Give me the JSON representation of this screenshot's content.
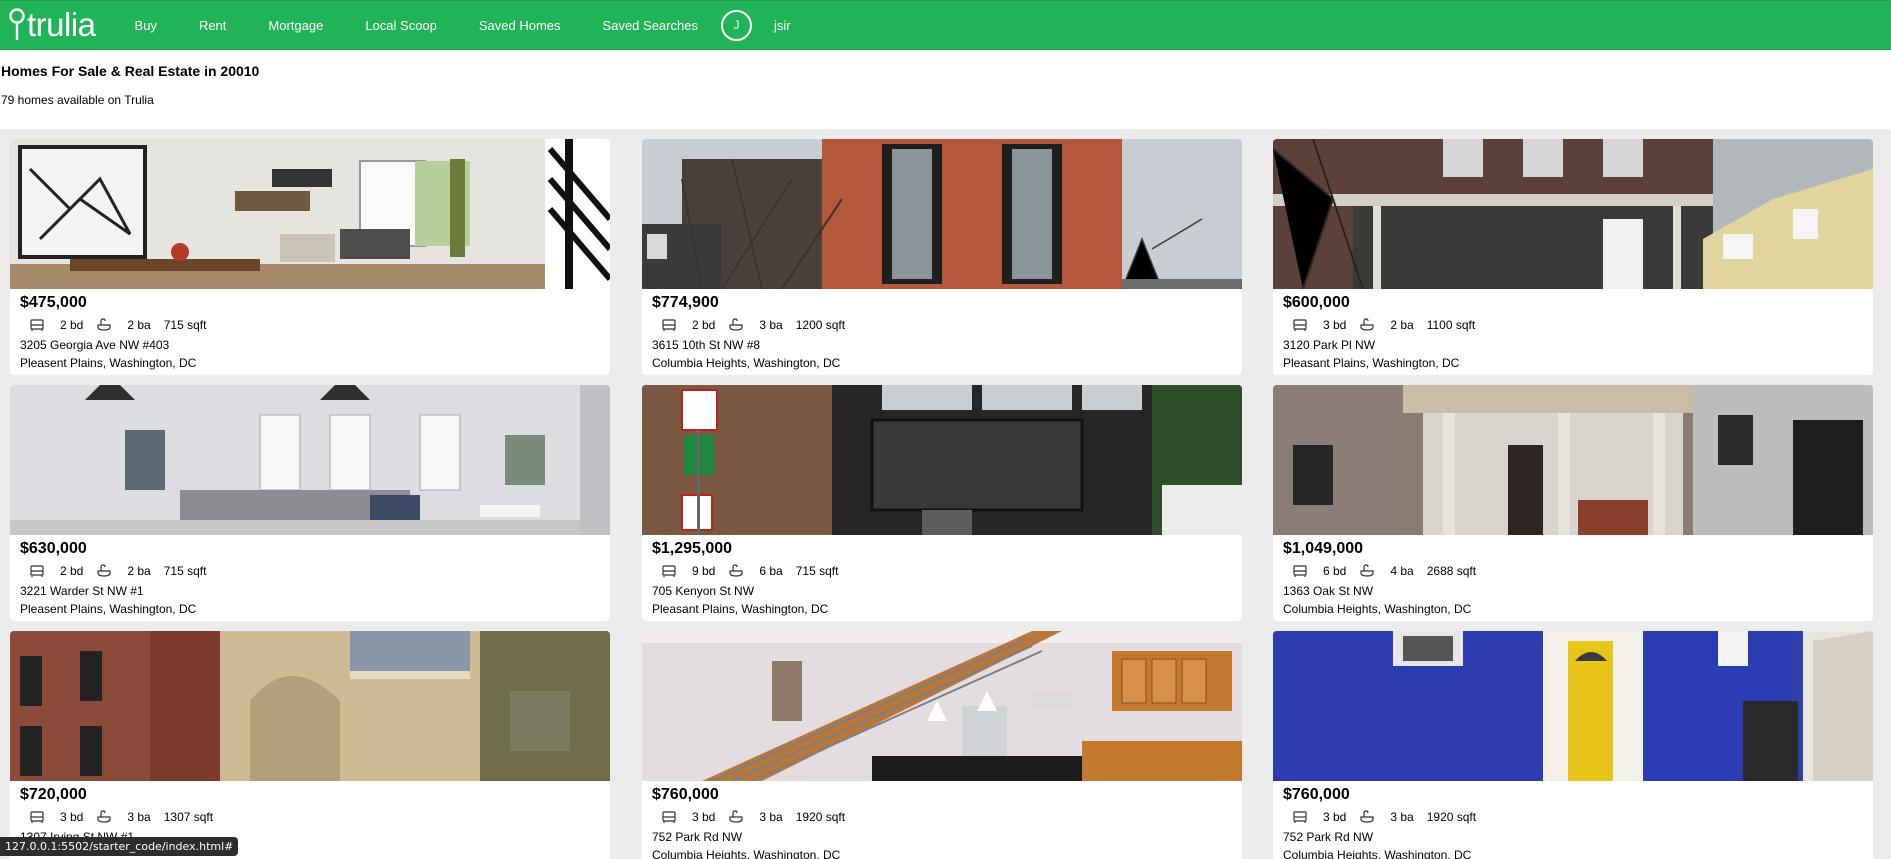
{
  "brand": {
    "name": "trulia",
    "accent": "#21b357"
  },
  "nav": {
    "links": [
      "Buy",
      "Rent",
      "Mortgage",
      "Local Scoop",
      "Saved Homes",
      "Saved Searches"
    ],
    "avatar_initial": "J",
    "username": "jsir"
  },
  "header": {
    "title": "Homes For Sale & Real Estate in 20010",
    "subtitle": "79 homes available on Trulia"
  },
  "listings": [
    {
      "price": "$475,000",
      "beds": "2 bd",
      "baths": "2 ba",
      "sqft": "715 sqft",
      "street": "3205 Georgia Ave NW #403",
      "locality": "Pleasent Plains, Washington, DC"
    },
    {
      "price": "$774,900",
      "beds": "2 bd",
      "baths": "3 ba",
      "sqft": "1200 sqft",
      "street": "3615 10th St NW #8",
      "locality": "Columbia Heights, Washington, DC"
    },
    {
      "price": "$600,000",
      "beds": "3 bd",
      "baths": "2 ba",
      "sqft": "1100 sqft",
      "street": "3120 Park Pl NW",
      "locality": "Pleasant Plains, Washington, DC"
    },
    {
      "price": "$630,000",
      "beds": "2 bd",
      "baths": "2 ba",
      "sqft": "715 sqft",
      "street": "3221 Warder St NW #1",
      "locality": "Pleasent Plains, Washington, DC"
    },
    {
      "price": "$1,295,000",
      "beds": "9 bd",
      "baths": "6 ba",
      "sqft": "715 sqft",
      "street": "705 Kenyon St NW",
      "locality": "Pleasant Plains, Washington, DC"
    },
    {
      "price": "$1,049,000",
      "beds": "6 bd",
      "baths": "4 ba",
      "sqft": "2688 sqft",
      "street": "1363 Oak St NW",
      "locality": "Columbia Heights, Washington, DC"
    },
    {
      "price": "$720,000",
      "beds": "3 bd",
      "baths": "3 ba",
      "sqft": "1307 sqft",
      "street": "1307 Irving St NW #1",
      "locality": ""
    },
    {
      "price": "$760,000",
      "beds": "3 bd",
      "baths": "3 ba",
      "sqft": "1920 sqft",
      "street": "752 Park Rd NW",
      "locality": "Columbia Heights, Washington, DC"
    },
    {
      "price": "$760,000",
      "beds": "3 bd",
      "baths": "3 ba",
      "sqft": "1920 sqft",
      "street": "752 Park Rd NW",
      "locality": "Columbia Heights, Washington, DC"
    }
  ],
  "icons": {
    "bed": "bed-icon",
    "bath": "bath-icon",
    "logo_pin": "location-pin-icon"
  },
  "statusbar": {
    "url": "127.0.0.1:5502/starter_code/index.html#"
  }
}
